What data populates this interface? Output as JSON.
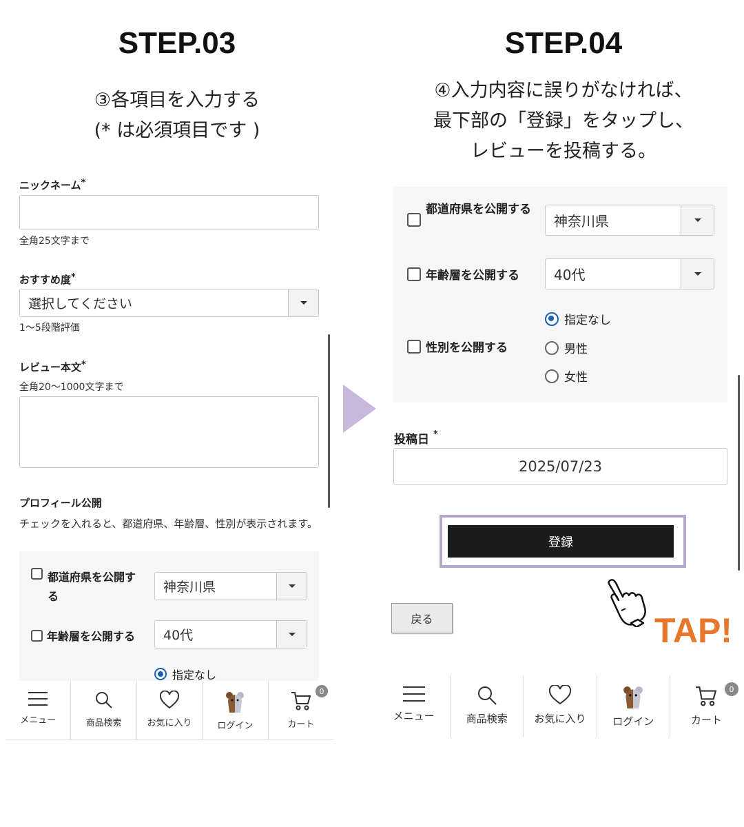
{
  "left": {
    "step_title": "STEP.03",
    "desc_line1": "③各項目を入力する",
    "desc_line2": "(* は必須項目です )",
    "nickname": {
      "label": "ニックネーム",
      "req": "*",
      "value": "",
      "hint": "全角25文字まで"
    },
    "rating": {
      "label": "おすすめ度",
      "req": "*",
      "value": "選択してください",
      "hint": "1〜5段階評価"
    },
    "review": {
      "label": "レビュー本文",
      "req": "*",
      "hint": "全角20〜1000文字まで",
      "value": ""
    },
    "profile": {
      "label": "プロフィール公開",
      "desc": "チェックを入れると、都道府県、年齢層、性別が表示されます。"
    },
    "pref": {
      "label": "都道府県を公開する",
      "value": "神奈川県"
    },
    "age": {
      "label": "年齢層を公開する",
      "value": "40代"
    },
    "gender_option": "指定なし"
  },
  "right": {
    "step_title": "STEP.04",
    "desc_line1": "④入力内容に誤りがなければ、",
    "desc_line2": "最下部の「登録」をタップし、",
    "desc_line3": "レビューを投稿する。",
    "pref": {
      "label": "都道府県を公開する",
      "value": "神奈川県"
    },
    "age": {
      "label": "年齢層を公開する",
      "value": "40代"
    },
    "gender": {
      "label": "性別を公開する",
      "options": [
        "指定なし",
        "男性",
        "女性"
      ],
      "selected": "指定なし"
    },
    "post_date": {
      "label": "投稿日",
      "req": "*",
      "value": "2025/07/23"
    },
    "submit_label": "登録",
    "back_label": "戻る",
    "tap_text": "TAP!"
  },
  "nav": {
    "menu": "メニュー",
    "search": "商品検索",
    "favorite": "お気に入り",
    "login": "ログイン",
    "cart": "カート",
    "cart_count": "0"
  },
  "colors": {
    "accent_purple": "#b5a6cc",
    "arrow_purple": "#c9b8dc",
    "tap_orange": "#e8772e",
    "radio_blue": "#1a5fb4",
    "submit_bg": "#1c1c1c"
  }
}
